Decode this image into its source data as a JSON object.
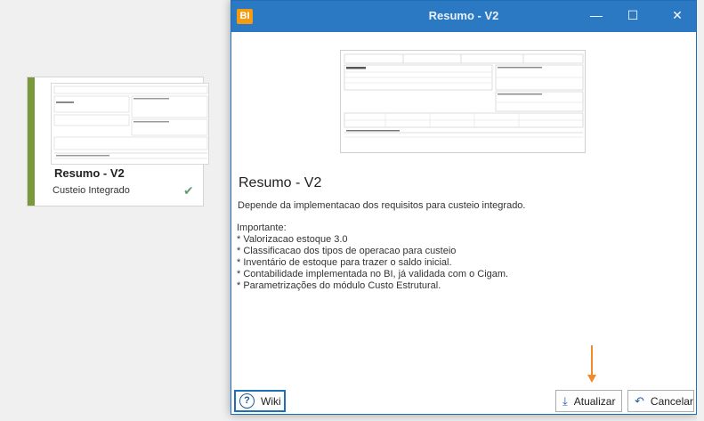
{
  "card": {
    "title": "Resumo - V2",
    "subtitle": "Custeio Integrado",
    "check_icon": "check-icon",
    "accent_color": "#7a9a3a"
  },
  "dialog": {
    "app_icon_label": "BI",
    "title": "Resumo - V2",
    "minimize_glyph": "—",
    "maximize_glyph": "☐",
    "close_glyph": "✕",
    "titlebar_color": "#2b79c2"
  },
  "content": {
    "heading": "Resumo - V2",
    "description": "Depende da implementacao dos requisitos para custeio integrado.",
    "notes_title": "Importante:",
    "notes": [
      "* Valorizacao estoque 3.0",
      "* Classificacao dos tipos de operacao para custeio",
      "* Inventário de estoque para trazer o saldo inicial.",
      "* Contabilidade implementada no BI, já validada com o Cigam.",
      "* Parametrizações do módulo Custo Estrutural."
    ]
  },
  "footer": {
    "wiki_label": "Wiki",
    "wiki_icon": "help-icon",
    "update_label": "Atualizar",
    "update_icon": "download-icon",
    "cancel_label": "Cancelar",
    "cancel_icon": "undo-icon"
  }
}
